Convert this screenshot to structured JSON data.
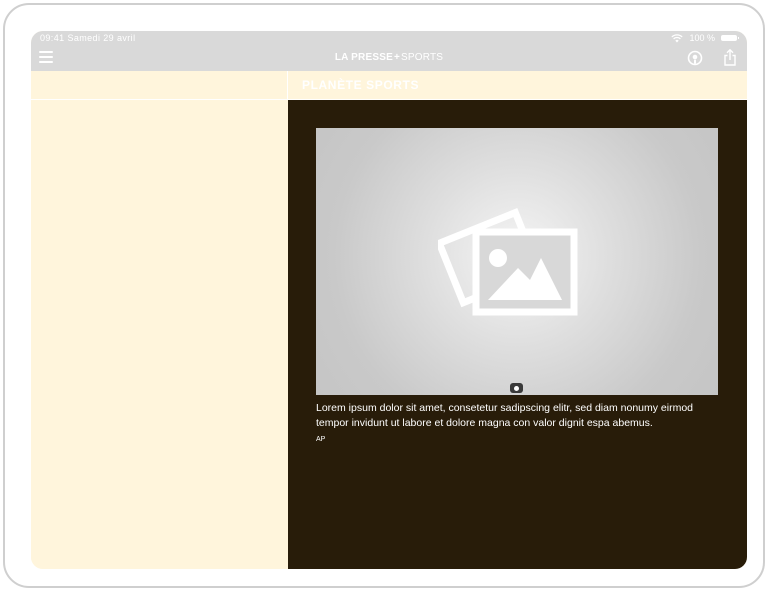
{
  "status_bar": {
    "time": "09:41",
    "date": "Samedi 29 avril",
    "battery": "100 %",
    "wifi_icon": "wifi-icon",
    "battery_icon": "battery-icon"
  },
  "nav": {
    "brand_main": "LA PRESSE",
    "brand_plus": "+",
    "brand_sub": "SPORTS",
    "menu_icon": "menu-icon",
    "podcast_icon": "podcast-icon",
    "share_icon": "share-icon"
  },
  "section": {
    "title": "PLANÈTE SPORTS"
  },
  "article": {
    "image_icon": "image-placeholder-icon",
    "camera_icon": "camera-icon",
    "caption": "Lorem ipsum dolor sit amet, consetetur sadipscing elitr, sed diam nonumy eirmod tempor invidunt ut labore et dolore magna con valor dignit espa abemus.",
    "credit": "AP"
  },
  "colors": {
    "cream": "#fff5dc",
    "dark_brown": "#281c09",
    "bar_grey": "#d9d9d9"
  }
}
